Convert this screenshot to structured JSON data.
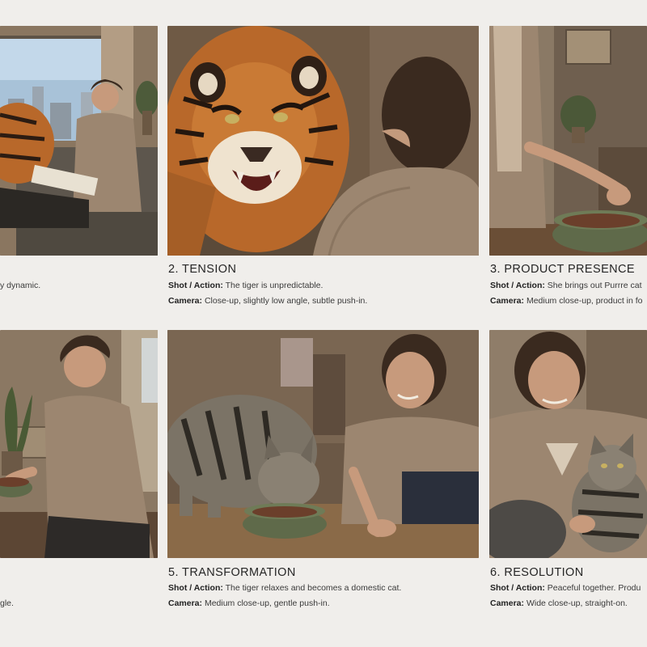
{
  "frames": [
    {
      "heading": "",
      "shot_label": "",
      "shot_text": "y dynamic.",
      "camera_label": "",
      "camera_text": ""
    },
    {
      "heading": "2. TENSION",
      "shot_label": "Shot / Action:",
      "shot_text": "The tiger is unpredictable.",
      "camera_label": "Camera:",
      "camera_text": "Close-up, slightly low angle, subtle push-in."
    },
    {
      "heading": "3. PRODUCT PRESENCE",
      "shot_label": "Shot / Action:",
      "shot_text": "She brings out Purrre cat",
      "camera_label": "Camera:",
      "camera_text": "Medium close-up, product in fo"
    },
    {
      "heading": "",
      "shot_label": "",
      "shot_text": "",
      "camera_label": "",
      "camera_text": "gle."
    },
    {
      "heading": "5. TRANSFORMATION",
      "shot_label": "Shot / Action:",
      "shot_text": "The tiger relaxes and becomes a domestic cat.",
      "camera_label": "Camera:",
      "camera_text": "Medium close-up, gentle push-in."
    },
    {
      "heading": "6. RESOLUTION",
      "shot_label": "Shot / Action:",
      "shot_text": "Peaceful together. Produ",
      "camera_label": "Camera:",
      "camera_text": "Wide close-up, straight-on."
    }
  ],
  "colors": {
    "page_background": "#f0eeeb",
    "tiger_orange": "#b8682a",
    "cat_gray": "#7b7366",
    "sweater": "#9c8670",
    "bowl_green": "#5f6a4a"
  },
  "icons": {
    "window": "window-icon",
    "plant": "plant-icon"
  }
}
